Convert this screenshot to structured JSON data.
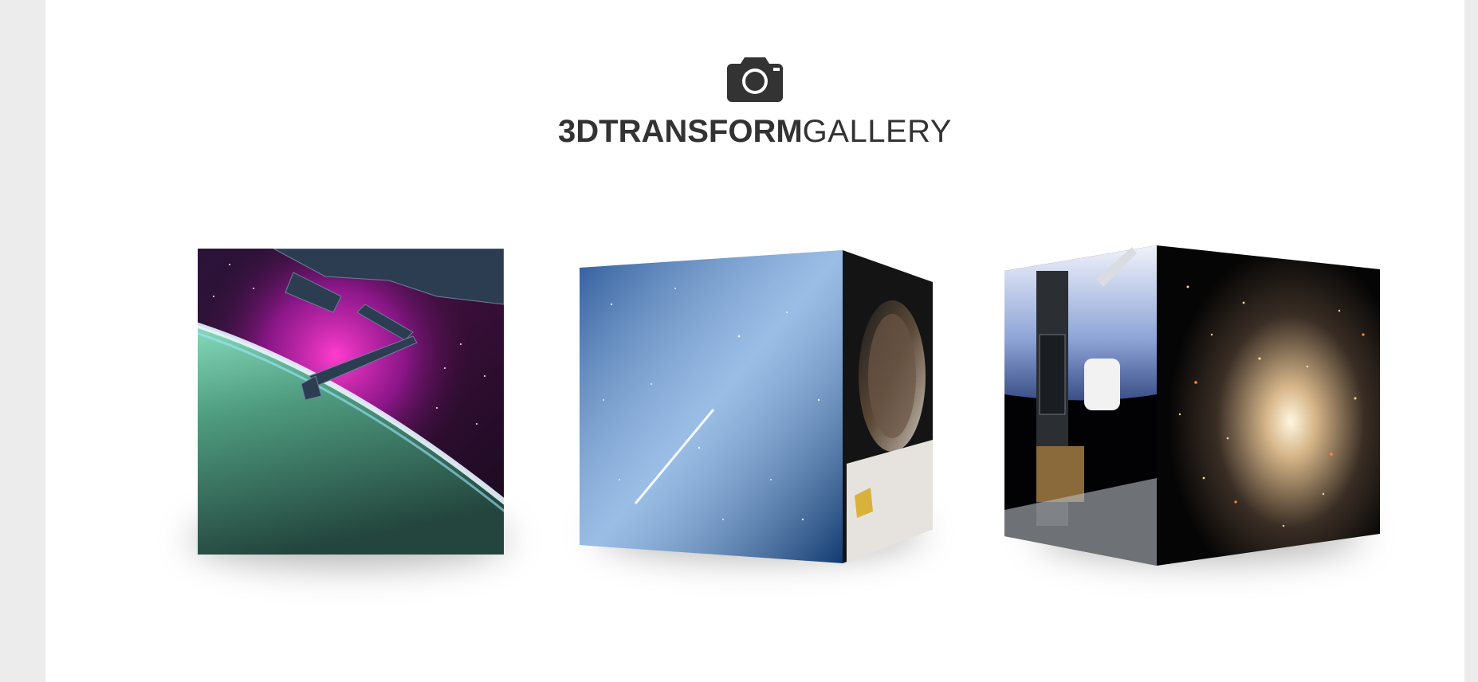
{
  "header": {
    "icon": "camera-icon",
    "brand_bold": "3DTRANSFORM",
    "brand_light": "GALLERY"
  },
  "colors": {
    "page_bg": "#ffffff",
    "outer_bg": "#ececec",
    "text": "#333333"
  },
  "gallery": {
    "items": [
      {
        "name": "aurora-earth-station-photo",
        "faces": [
          "aurora-over-earth-with-station-arm"
        ]
      },
      {
        "name": "milky-way-astronaut-cube",
        "faces": [
          "milky-way-meteor",
          "astronaut-helmet-reflection"
        ]
      },
      {
        "name": "shuttle-star-cluster-cube",
        "faces": [
          "shuttle-arm-over-earth",
          "globular-star-cluster"
        ]
      }
    ]
  }
}
